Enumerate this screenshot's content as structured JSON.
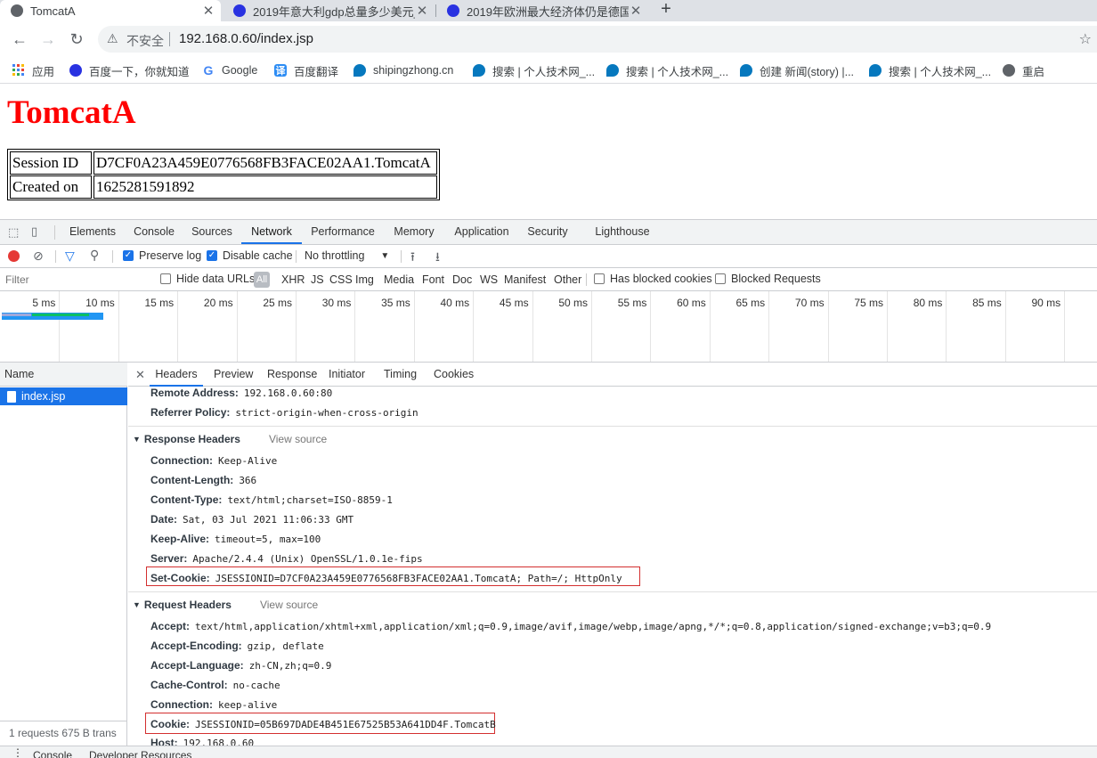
{
  "tabs": [
    {
      "title": "TomcatA",
      "active": true
    },
    {
      "title": "2019年意大利gdp总量多少美元_"
    },
    {
      "title": "2019年欧洲最大经济体仍是德国"
    }
  ],
  "newtab": "+",
  "address": {
    "warning": "不安全",
    "url": "192.168.0.60/index.jsp"
  },
  "bookmarks": [
    {
      "icon": "apps-icon",
      "label": "应用"
    },
    {
      "icon": "baidu-paw-icon",
      "label": "百度一下，你就知道"
    },
    {
      "icon": "google-icon",
      "label": "Google"
    },
    {
      "icon": "translate-icon",
      "label": "百度翻译"
    },
    {
      "icon": "drupal-icon",
      "label": "shipingzhong.cn"
    },
    {
      "icon": "drupal-icon",
      "label": "搜索 | 个人技术网_..."
    },
    {
      "icon": "drupal-icon",
      "label": "搜索 | 个人技术网_..."
    },
    {
      "icon": "drupal-icon",
      "label": "创建 新闻(story) |..."
    },
    {
      "icon": "drupal-icon",
      "label": "搜索 | 个人技术网_..."
    },
    {
      "icon": "globe-icon",
      "label": "重启"
    }
  ],
  "page": {
    "title": "TomcatA",
    "session_label": "Session ID",
    "session_value": "D7CF0A23A459E0776568FB3FACE02AA1.TomcatA",
    "created_label": "Created on",
    "created_value": "1625281591892"
  },
  "devtools": {
    "tabs": [
      "Elements",
      "Console",
      "Sources",
      "Network",
      "Performance",
      "Memory",
      "Application",
      "Security",
      "Lighthouse"
    ],
    "active_tab": "Network",
    "toolbar": {
      "preserve_log": "Preserve log",
      "disable_cache": "Disable cache",
      "throttling": "No throttling"
    },
    "filter_placeholder": "Filter",
    "hide_data_urls": "Hide data URLs",
    "types": [
      "All",
      "XHR",
      "JS",
      "CSS",
      "Img",
      "Media",
      "Font",
      "Doc",
      "WS",
      "Manifest",
      "Other"
    ],
    "has_blocked_cookies": "Has blocked cookies",
    "blocked_requests": "Blocked Requests",
    "timeline_ticks": [
      "5 ms",
      "10 ms",
      "15 ms",
      "20 ms",
      "25 ms",
      "30 ms",
      "35 ms",
      "40 ms",
      "45 ms",
      "50 ms",
      "55 ms",
      "60 ms",
      "65 ms",
      "70 ms",
      "75 ms",
      "80 ms",
      "85 ms",
      "90 ms",
      "9"
    ],
    "name_header": "Name",
    "request_name": "index.jsp",
    "status": "1 requests   675 B trans",
    "detail_tabs": [
      "Headers",
      "Preview",
      "Response",
      "Initiator",
      "Timing",
      "Cookies"
    ],
    "general": [
      {
        "k": "Remote Address:",
        "v": "192.168.0.60:80"
      },
      {
        "k": "Referrer Policy:",
        "v": "strict-origin-when-cross-origin"
      }
    ],
    "response_title": "Response Headers",
    "view_source": "View source",
    "response_headers": [
      {
        "k": "Connection:",
        "v": "Keep-Alive"
      },
      {
        "k": "Content-Length:",
        "v": "366"
      },
      {
        "k": "Content-Type:",
        "v": "text/html;charset=ISO-8859-1"
      },
      {
        "k": "Date:",
        "v": "Sat, 03 Jul 2021 11:06:33 GMT"
      },
      {
        "k": "Keep-Alive:",
        "v": "timeout=5, max=100"
      },
      {
        "k": "Server:",
        "v": "Apache/2.4.4 (Unix) OpenSSL/1.0.1e-fips"
      },
      {
        "k": "Set-Cookie:",
        "v": "JSESSIONID=D7CF0A23A459E0776568FB3FACE02AA1.TomcatA; Path=/; HttpOnly"
      }
    ],
    "request_title": "Request Headers",
    "request_headers": [
      {
        "k": "Accept:",
        "v": "text/html,application/xhtml+xml,application/xml;q=0.9,image/avif,image/webp,image/apng,*/*;q=0.8,application/signed-exchange;v=b3;q=0.9"
      },
      {
        "k": "Accept-Encoding:",
        "v": "gzip, deflate"
      },
      {
        "k": "Accept-Language:",
        "v": "zh-CN,zh;q=0.9"
      },
      {
        "k": "Cache-Control:",
        "v": "no-cache"
      },
      {
        "k": "Connection:",
        "v": "keep-alive"
      },
      {
        "k": "Cookie:",
        "v": "JSESSIONID=05B697DADE4B451E67525B53A641DD4F.TomcatB"
      },
      {
        "k": "Host:",
        "v": "192.168.0.60"
      }
    ],
    "drawer": [
      "Console",
      "Developer Resources"
    ]
  }
}
